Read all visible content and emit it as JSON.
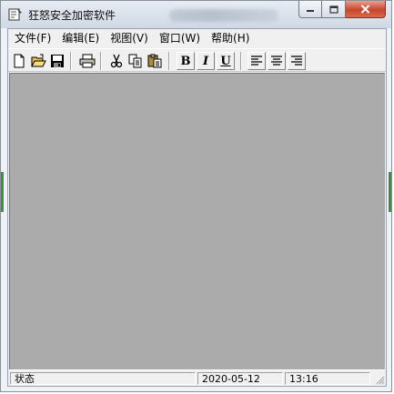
{
  "window": {
    "title": "狂怒安全加密软件",
    "accent_close": "#c7452c"
  },
  "menu": [
    {
      "label": "文件(F)"
    },
    {
      "label": "编辑(E)"
    },
    {
      "label": "视图(V)"
    },
    {
      "label": "窗口(W)"
    },
    {
      "label": "帮助(H)"
    }
  ],
  "toolbar": {
    "new_icon": "new-document-icon",
    "open_icon": "open-folder-icon",
    "save_icon": "save-disk-icon",
    "print_icon": "printer-icon",
    "cut_icon": "scissors-icon",
    "copy_icon": "copy-icon",
    "paste_icon": "paste-clipboard-icon",
    "bold_label": "B",
    "italic_label": "I",
    "underline_label": "U",
    "align_left_icon": "align-left-icon",
    "align_center_icon": "align-center-icon",
    "align_right_icon": "align-right-icon"
  },
  "status": {
    "state_label": "状态",
    "date": "2020-05-12",
    "time": "13:16"
  },
  "colors": {
    "workspace": "#ababab",
    "chrome": "#f0f0f0"
  }
}
